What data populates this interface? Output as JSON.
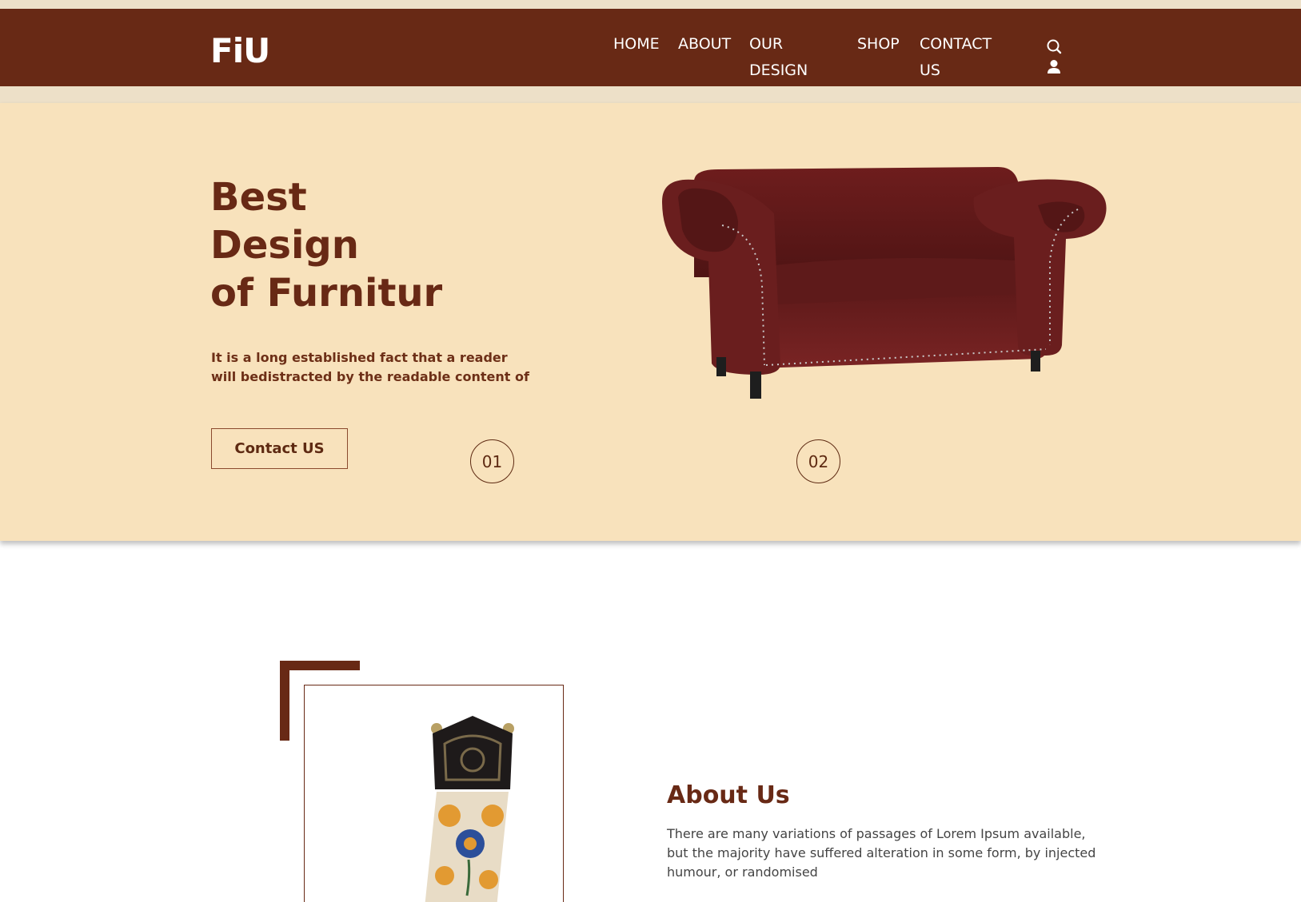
{
  "brand": {
    "logo": "FiU",
    "primary_color": "#682915",
    "hero_bg": "#f8e2bc",
    "strip_bg": "#ede0c8"
  },
  "nav": {
    "items": [
      {
        "label": "HOME"
      },
      {
        "label": "ABOUT"
      },
      {
        "label": "OUR DESIGN"
      },
      {
        "label": "SHOP"
      },
      {
        "label": "CONTACT US"
      }
    ],
    "icons": [
      "search-icon",
      "user-icon"
    ]
  },
  "hero": {
    "title_line1": "Best",
    "title_line2": "Design",
    "title_line3": "of Furnitur",
    "text": "It is a long established fact that a reader will bedistracted by the readable content of",
    "button_label": "Contact US",
    "slides": [
      "01",
      "02"
    ]
  },
  "about": {
    "title": "About Us",
    "text": "There are many variations of passages of Lorem Ipsum available, but the majority have suffered alteration in some form, by injected humour, or randomised"
  }
}
